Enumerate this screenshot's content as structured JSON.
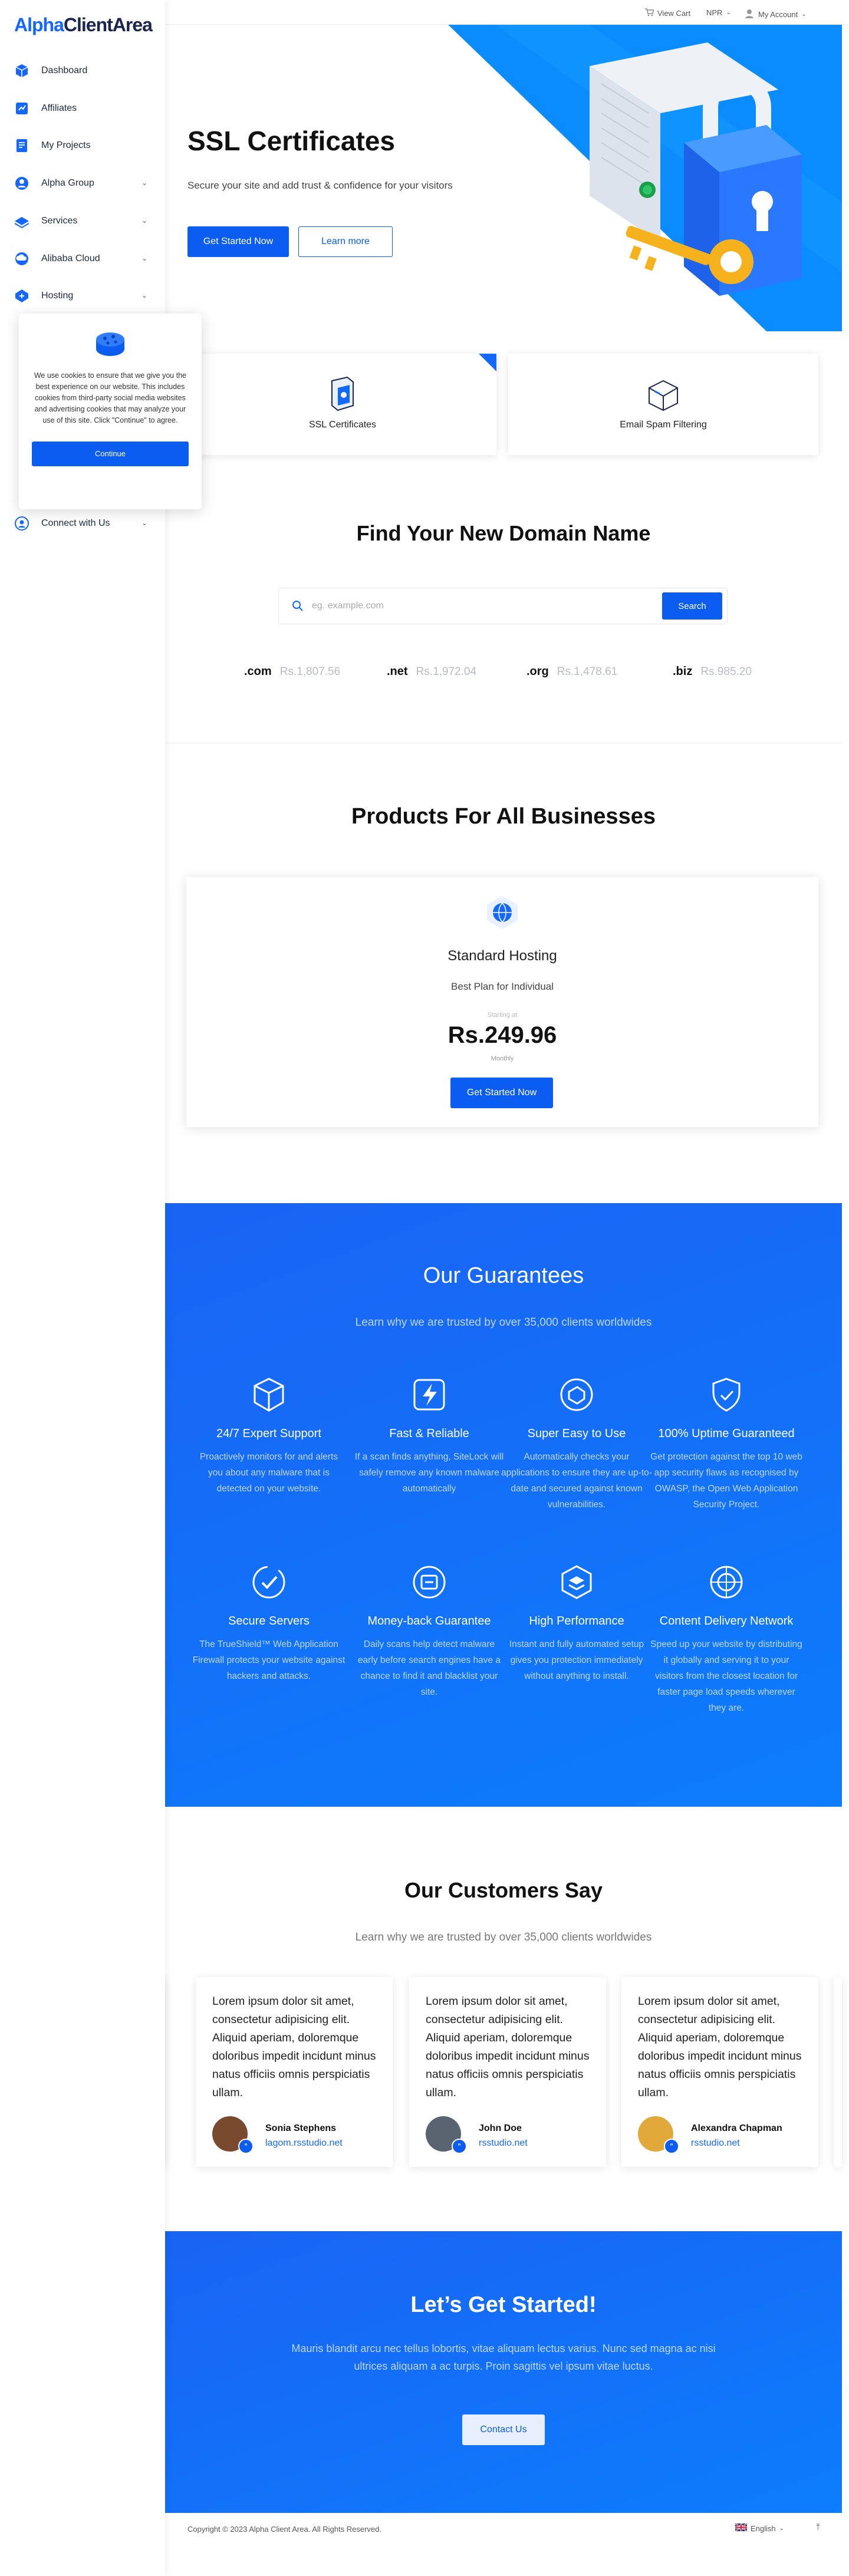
{
  "brand": {
    "logo_part1": "Alpha",
    "logo_part2": "ClientArea"
  },
  "sidebar": {
    "items": [
      {
        "label": "Dashboard",
        "icon": "dashboard-icon",
        "has_children": false
      },
      {
        "label": "Affiliates",
        "icon": "affiliates-icon",
        "has_children": false
      },
      {
        "label": "My Projects",
        "icon": "projects-icon",
        "has_children": false
      },
      {
        "label": "Alpha Group",
        "icon": "group-icon",
        "has_children": true
      },
      {
        "label": "Services",
        "icon": "services-icon",
        "has_children": true
      },
      {
        "label": "Alibaba Cloud",
        "icon": "cloud-icon",
        "has_children": true
      },
      {
        "label": "Hosting",
        "icon": "hosting-icon",
        "has_children": true
      },
      {
        "label": "Connect with Us",
        "icon": "connect-icon",
        "has_children": true
      }
    ]
  },
  "cookie": {
    "message": "We use cookies to ensure that we give you the best experience on our website. This includes cookies from third-party social media websites and advertising cookies that may analyze your use of this site. Click \"Continue\" to agree.",
    "button": "Continue"
  },
  "topbar": {
    "cart": "View Cart",
    "currency": "NPR",
    "account": "My Account"
  },
  "hero": {
    "title": "SSL Certificates",
    "subtitle": "Secure your site and add trust & confidence for your visitors",
    "primary_button": "Get Started Now",
    "secondary_button": "Learn more"
  },
  "features": [
    {
      "label": "SSL Certificates"
    },
    {
      "label": "Email Spam Filtering"
    }
  ],
  "domain": {
    "title": "Find Your New Domain Name",
    "placeholder": "eg. example.com",
    "button": "Search",
    "tlds": [
      {
        "ext": ".com",
        "price": "Rs.1,807.56"
      },
      {
        "ext": ".net",
        "price": "Rs.1,972.04"
      },
      {
        "ext": ".org",
        "price": "Rs.1,478.61"
      },
      {
        "ext": ".biz",
        "price": "Rs.985.20"
      }
    ]
  },
  "products": {
    "title": "Products For All Businesses",
    "card": {
      "name": "Standard Hosting",
      "tagline": "Best Plan for Individual",
      "starting": "Starting at",
      "price": "Rs.249.96",
      "period": "Monthly",
      "button": "Get Started Now"
    }
  },
  "guarantees": {
    "title": "Our Guarantees",
    "subtitle": "Learn why we are trusted by over 35,000 clients worldwides",
    "items": [
      {
        "title": "24/7 Expert Support",
        "desc": "Proactively monitors for and alerts you about any malware that is detected on your website."
      },
      {
        "title": "Fast & Reliable",
        "desc": "If a scan finds anything, SiteLock will safely remove any known malware automatically"
      },
      {
        "title": "Super Easy to Use",
        "desc": "Automatically checks your applications to ensure they are up-to-date and secured against known vulnerabilities."
      },
      {
        "title": "100% Uptime Guaranteed",
        "desc": "Get protection against the top 10 web app security flaws as recognised by OWASP, the Open Web Application Security Project."
      },
      {
        "title": "Secure Servers",
        "desc": "The TrueShield™ Web Application Firewall protects your website against hackers and attacks."
      },
      {
        "title": "Money-back Guarantee",
        "desc": "Daily scans help detect malware early before search engines have a chance to find it and blacklist your site."
      },
      {
        "title": "High Performance",
        "desc": "Instant and fully automated setup gives you protection immediately without anything to install."
      },
      {
        "title": "Content Delivery Network",
        "desc": "Speed up your website by distributing it globally and serving it to your visitors from the closest location for faster page load speeds wherever they are."
      }
    ]
  },
  "testimonials": {
    "title": "Our Customers Say",
    "subtitle": "Learn why we are trusted by over 35,000 clients worldwides",
    "items": [
      {
        "quote": "Lorem ipsum dolor sit amet, consectetur adipisicing elit. Aliquid aperiam, doloremque doloribus impedit incidunt minus natus officiis omnis perspiciatis ullam.",
        "name": "Sonia Stephens",
        "link": "lagom.rsstudio.net",
        "avatar_color": "#7a4a2e"
      },
      {
        "quote": "Lorem ipsum dolor sit amet, consectetur adipisicing elit. Aliquid aperiam, doloremque doloribus impedit incidunt minus natus officiis omnis perspiciatis ullam.",
        "name": "John Doe",
        "link": "rsstudio.net",
        "avatar_color": "#5a6470"
      },
      {
        "quote": "Lorem ipsum dolor sit amet, consectetur adipisicing elit. Aliquid aperiam, doloremque doloribus impedit incidunt minus natus officiis omnis perspiciatis ullam.",
        "name": "Alexandra Chapman",
        "link": "rsstudio.net",
        "avatar_color": "#e0a93a"
      }
    ]
  },
  "cta": {
    "title": "Let’s Get Started!",
    "text": "Mauris blandit arcu nec tellus lobortis, vitae aliquam lectus varius. Nunc sed magna ac nisi ultrices aliquam a ac turpis. Proin sagittis vel ipsum vitae luctus.",
    "button": "Contact Us"
  },
  "footer": {
    "copyright": "Copyright © 2023 Alpha Client Area. All Rights Reserved.",
    "language": "English"
  },
  "colors": {
    "primary": "#0b5cf0",
    "brand_blue": "#1468ff",
    "navy": "#1a2550"
  }
}
